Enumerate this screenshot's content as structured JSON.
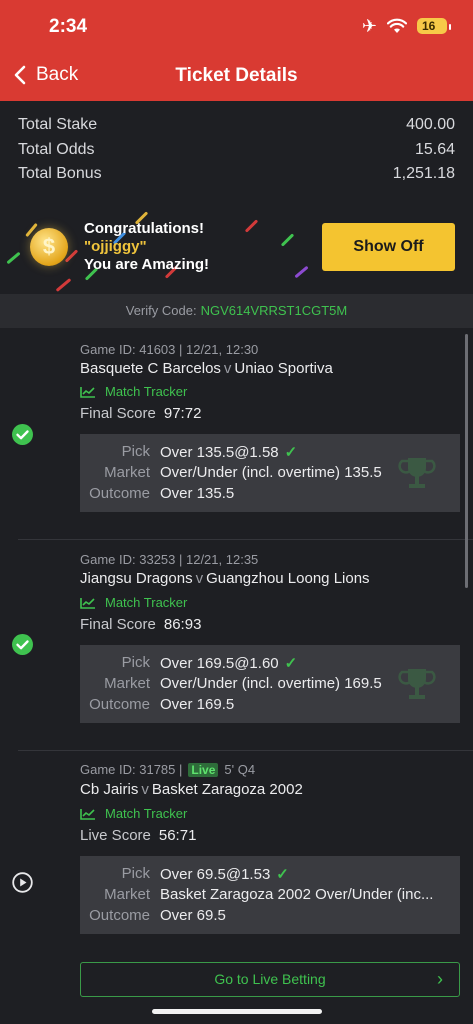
{
  "status_bar": {
    "time": "2:34",
    "battery": "16"
  },
  "header": {
    "back_label": "Back",
    "title": "Ticket Details"
  },
  "totals": [
    {
      "label": "Total Stake",
      "value": "400.00"
    },
    {
      "label": "Total Odds",
      "value": "15.64"
    },
    {
      "label": "Total Bonus",
      "value": "1,251.18"
    }
  ],
  "congrats": {
    "line1": "Congratulations!",
    "name": "\"ojjiggy\"",
    "line3": "You are Amazing!",
    "show_off": "Show Off",
    "coin_symbol": "$"
  },
  "verify": {
    "label": "Verify Code:",
    "code": "NGV614VRRST1CGT5M"
  },
  "labels": {
    "pick": "Pick",
    "market": "Market",
    "outcome": "Outcome",
    "match_tracker": "Match Tracker",
    "versus": "v",
    "check": "✓"
  },
  "bets": [
    {
      "status": "won",
      "game_info": "Game ID: 41603 | 12/21, 12:30",
      "home": "Basquete C Barcelos",
      "away": "Uniao Sportiva",
      "score_label": "Final Score",
      "score": "97:72",
      "pick": "Over 135.5@1.58",
      "market": "Over/Under (incl. overtime) 135.5",
      "outcome": "Over 135.5"
    },
    {
      "status": "won",
      "game_info": "Game ID: 33253 | 12/21, 12:35",
      "home": "Jiangsu Dragons",
      "away": "Guangzhou Loong Lions",
      "score_label": "Final Score",
      "score": "86:93",
      "pick": "Over 169.5@1.60",
      "market": "Over/Under (incl. overtime) 169.5",
      "outcome": "Over 169.5"
    },
    {
      "status": "live",
      "game_info": "Game ID: 31785 |",
      "live_badge": "Live",
      "live_time": "5' Q4",
      "home": "Cb Jairis",
      "away": "Basket Zaragoza 2002",
      "score_label": "Live Score",
      "score": "56:71",
      "pick": "Over 69.5@1.53",
      "market": "Basket Zaragoza 2002 Over/Under (inc...",
      "outcome": "Over 69.5"
    }
  ],
  "live_button": {
    "label": "Go to Live Betting",
    "arrow": "›"
  },
  "colors": {
    "header": "#d93a32",
    "background": "#1e1f23",
    "accent_green": "#3fc24f",
    "button_yellow": "#f4c430"
  },
  "icons": [
    "airplane-icon",
    "wifi-icon",
    "battery-icon",
    "chevron-left-icon",
    "coin-icon",
    "check-circle-icon",
    "chart-icon",
    "trophy-icon",
    "play-circle-icon",
    "chevron-right-icon"
  ]
}
